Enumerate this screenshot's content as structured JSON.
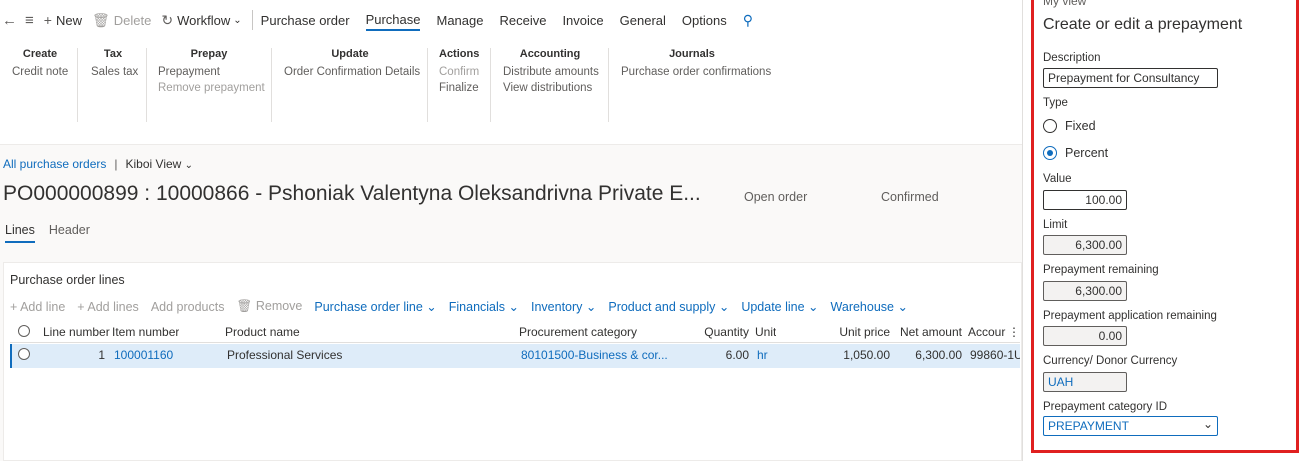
{
  "toolbar": {
    "new": "New",
    "delete": "Delete",
    "workflow": "Workflow",
    "tabs": [
      "Purchase order",
      "Purchase",
      "Manage",
      "Receive",
      "Invoice",
      "General",
      "Options"
    ]
  },
  "ribbon": {
    "create": {
      "title": "Create",
      "items": [
        "Credit note"
      ]
    },
    "tax": {
      "title": "Tax",
      "items": [
        "Sales tax"
      ]
    },
    "prepay": {
      "title": "Prepay",
      "items": [
        "Prepayment",
        "Remove prepayment"
      ]
    },
    "update": {
      "title": "Update",
      "items": [
        "Order Confirmation Details"
      ]
    },
    "actions": {
      "title": "Actions",
      "items": [
        "Confirm",
        "Finalize"
      ]
    },
    "accounting": {
      "title": "Accounting",
      "items": [
        "Distribute amounts",
        "View distributions"
      ]
    },
    "journals": {
      "title": "Journals",
      "items": [
        "Purchase order confirmations"
      ]
    }
  },
  "breadcrumb": {
    "link": "All purchase orders",
    "sep": "|",
    "view": "Kiboi View"
  },
  "page": {
    "title": "PO000000899 : 10000866 - Pshoniak Valentyna Oleksandrivna Private E...",
    "status1": "Open order",
    "status2": "Confirmed",
    "tabs": [
      "Lines",
      "Header"
    ]
  },
  "lines": {
    "title": "Purchase order lines",
    "actions": [
      "Add line",
      "Add lines",
      "Add products",
      "Remove",
      "Purchase order line",
      "Financials",
      "Inventory",
      "Product and supply",
      "Update line",
      "Warehouse"
    ],
    "columns": [
      "Line number",
      "Item number",
      "Product name",
      "Procurement category",
      "Quantity",
      "Unit",
      "Unit price",
      "Net amount",
      "Accour"
    ],
    "rows": [
      {
        "line": "1",
        "item": "100001160",
        "product": "Professional Services",
        "category": "80101500-Business & cor...",
        "qty": "6.00",
        "unit": "hr",
        "price": "1,050.00",
        "net": "6,300.00",
        "account": "99860-1U"
      }
    ]
  },
  "panel": {
    "myview": "My view",
    "title": "Create or edit a prepayment",
    "description_label": "Description",
    "description": "Prepayment for Consultancy",
    "type_label": "Type",
    "type_options": [
      "Fixed",
      "Percent"
    ],
    "type_selected": "Percent",
    "value_label": "Value",
    "value": "100.00",
    "limit_label": "Limit",
    "limit": "6,300.00",
    "remaining_label": "Prepayment remaining",
    "remaining": "6,300.00",
    "app_remaining_label": "Prepayment application remaining",
    "app_remaining": "0.00",
    "currency_label": "Currency/ Donor Currency",
    "currency": "UAH",
    "category_label": "Prepayment category ID",
    "category": "PREPAYMENT"
  }
}
